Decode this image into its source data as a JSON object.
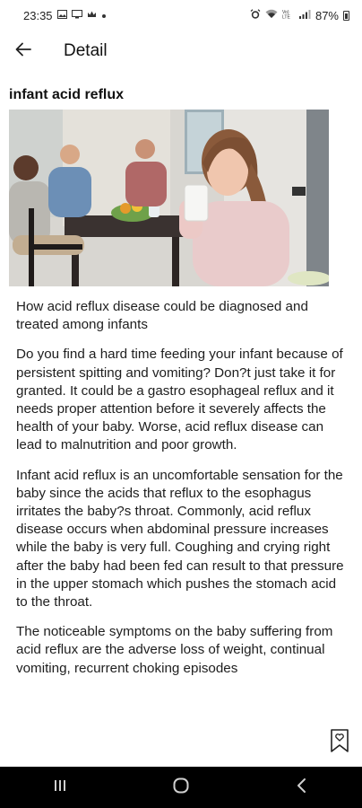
{
  "status_bar": {
    "time": "23:35",
    "left_icons": [
      "photo-icon",
      "monitor-icon",
      "crown-icon",
      "dot-icon"
    ],
    "right_icons": [
      "alarm-icon",
      "wifi-icon",
      "volte-icon",
      "signal-icon"
    ],
    "battery": "87%"
  },
  "app_bar": {
    "title": "Detail"
  },
  "article": {
    "title": "infant acid reflux",
    "paragraphs": [
      "How acid reflux disease could be diagnosed and treated among infants",
      "Do you find a hard time feeding your infant because of persistent spitting and vomiting? Don?t just take it for granted. It could be a gastro esophageal reflux and it needs proper attention before it severely affects the health of your baby. Worse, acid reflux disease can lead to malnutrition and poor growth.",
      "Infant acid reflux is an uncomfortable sensation for the baby since the acids that reflux to the esophagus irritates the baby?s throat. Commonly, acid reflux disease occurs when abdominal pressure increases while the baby is very full. Coughing and crying right after the baby had been fed can result to that pressure in the upper stomach which pushes the stomach acid to the throat.",
      "The noticeable symptoms on the baby suffering from acid reflux are the adverse loss of weight, continual vomiting, recurrent choking episodes"
    ]
  },
  "nav": {
    "buttons": [
      "recent-apps",
      "home",
      "back"
    ]
  }
}
